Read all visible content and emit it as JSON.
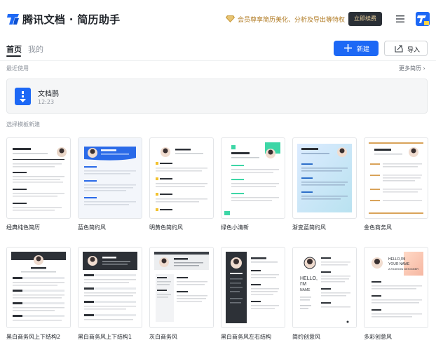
{
  "header": {
    "app_title": "腾讯文档 · 简历助手",
    "promo_text": "会员尊享简历美化、分析及导出等特权",
    "member_button": "立即续费",
    "colors": {
      "brand": "#1d68f5",
      "promo": "#b07a22",
      "member_bg": "#2a2f36"
    }
  },
  "tabs": [
    {
      "label": "首页",
      "active": true
    },
    {
      "label": "我的",
      "active": false
    }
  ],
  "actions": {
    "new_label": "新建",
    "import_label": "导入"
  },
  "recent": {
    "section_label": "最近使用",
    "more_label": "更多简历 ›",
    "items": [
      {
        "name": "文档鹊",
        "time": "12:23"
      }
    ]
  },
  "templates": {
    "section_label": "选择模板新建",
    "items": [
      {
        "name": "经典纯色简历",
        "accent": "#3a3f46"
      },
      {
        "name": "蓝色简约风",
        "accent": "#2a6ae8"
      },
      {
        "name": "明黄色简约风",
        "accent": "#f2c230"
      },
      {
        "name": "绿色小清新",
        "accent": "#3dd6a6"
      },
      {
        "name": "渐变蓝简约风",
        "accent": "#8ab9f0"
      },
      {
        "name": "金色商务风",
        "accent": "#d9a35a"
      },
      {
        "name": "黑白商务风上下结构2",
        "accent": "#2d3137"
      },
      {
        "name": "黑白商务风上下结构1",
        "accent": "#2d3137"
      },
      {
        "name": "灰白商务风",
        "accent": "#bfc3c8"
      },
      {
        "name": "黑白商务风左右结构",
        "accent": "#2d3137"
      },
      {
        "name": "简约创意风",
        "accent": "#3a3f46"
      },
      {
        "name": "多彩创意风",
        "accent": "#f0a070"
      }
    ],
    "creative_lines": {
      "simple": [
        "HELLO,",
        "I'M",
        "NAME"
      ],
      "colorful": [
        "HELLO,I'M",
        "YOUR NAME",
        "A FASHION DESIGNER"
      ]
    }
  },
  "icons": {
    "logo": "tencent-docs-logo-icon",
    "promo": "diamond-icon",
    "menu": "menu-icon",
    "avatar": "user-avatar-icon",
    "new": "plus-icon",
    "import": "import-icon",
    "doc": "resume-doc-icon"
  }
}
